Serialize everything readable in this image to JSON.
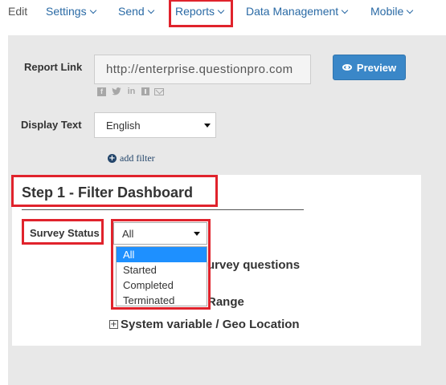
{
  "nav": {
    "edit": "Edit",
    "settings": "Settings",
    "send": "Send",
    "reports": "Reports",
    "data_management": "Data Management",
    "mobile": "Mobile"
  },
  "report_link": {
    "label": "Report Link",
    "url": "http://enterprise.questionpro.com",
    "preview_label": "Preview",
    "share_icons": [
      "facebook-icon",
      "twitter-icon",
      "linkedin-icon",
      "qr-code-icon",
      "email-icon"
    ]
  },
  "display_text": {
    "label": "Display Text",
    "selected": "English"
  },
  "add_filter": "add filter",
  "step": {
    "title": "Step 1 - Filter Dashboard",
    "survey_status_label": "Survey Status",
    "survey_status_selected": "All",
    "options": [
      "All",
      "Started",
      "Completed",
      "Terminated"
    ],
    "sections": {
      "survey_questions": "urvey questions",
      "range": "Range",
      "geo": "System variable / Geo Location"
    }
  },
  "colors": {
    "accent": "#2a6aa5",
    "highlight": "#e0232c",
    "button": "#3a87c8",
    "selected_option": "#1e90ff"
  }
}
